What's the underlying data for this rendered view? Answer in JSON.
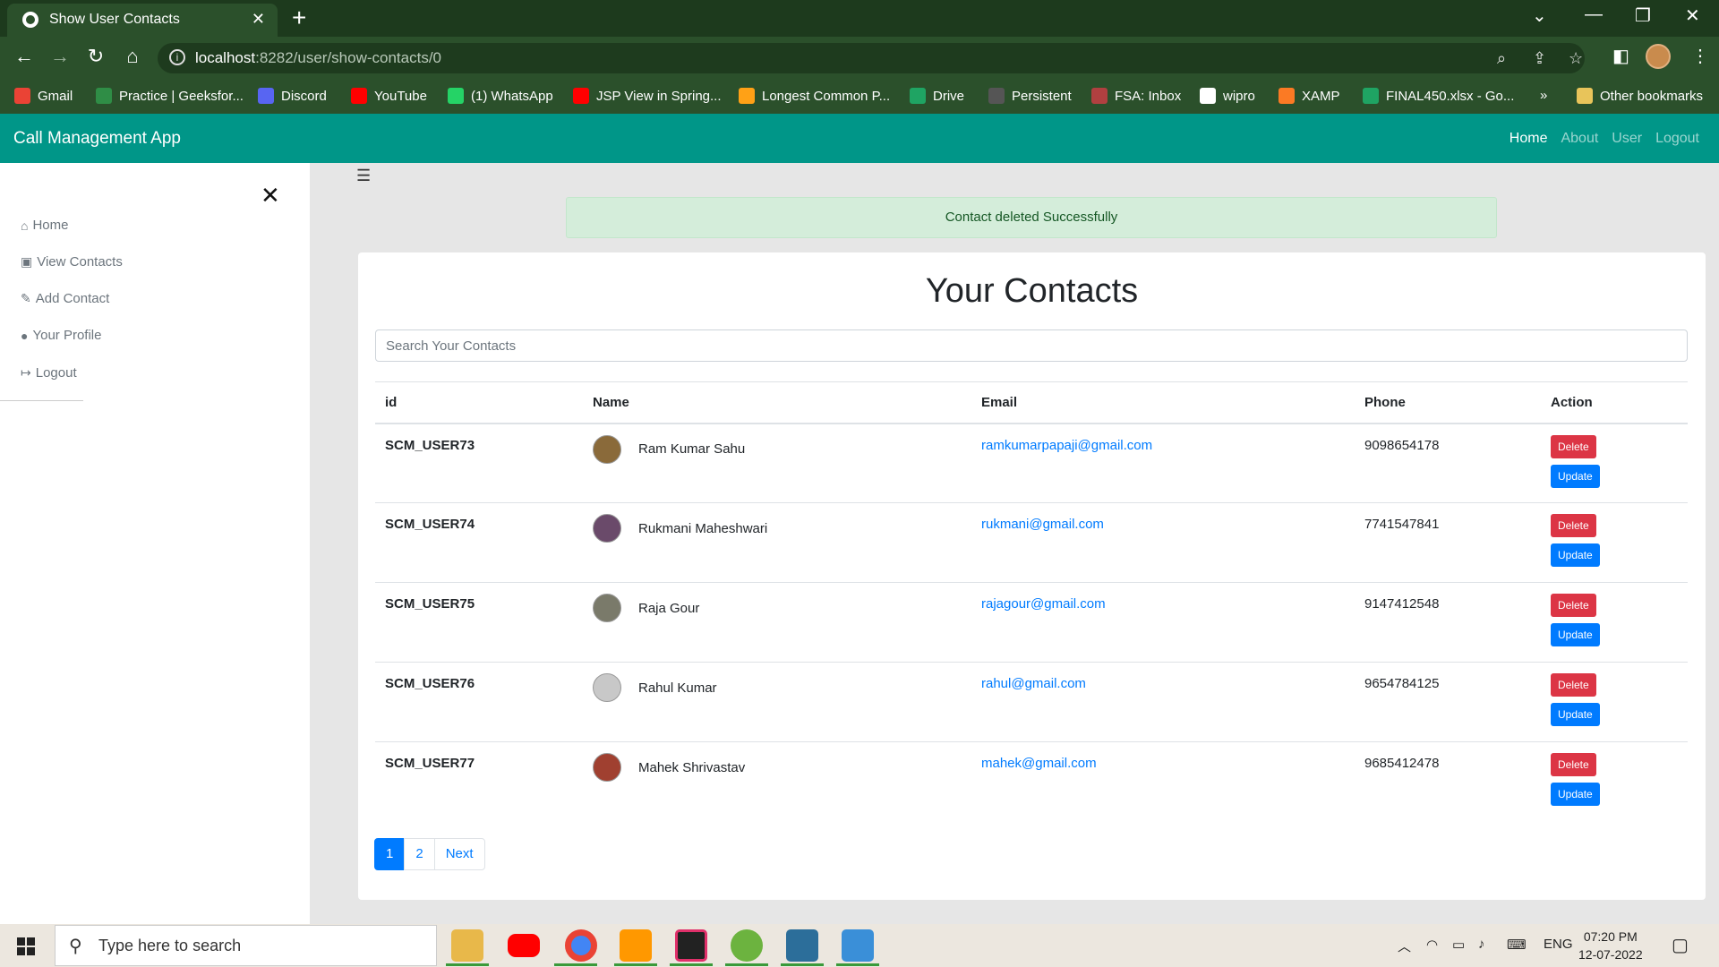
{
  "browser": {
    "tab_title": "Show User Contacts",
    "url_host": "localhost",
    "url_rest": ":8282/user/show-contacts/0",
    "bookmarks": [
      {
        "label": "Gmail",
        "color": "#ea4335"
      },
      {
        "label": "Practice | Geeksfor...",
        "color": "#2f8d46"
      },
      {
        "label": "Discord",
        "color": "#5865f2"
      },
      {
        "label": "YouTube",
        "color": "#ff0000"
      },
      {
        "label": "(1) WhatsApp",
        "color": "#25d366"
      },
      {
        "label": "JSP View in Spring...",
        "color": "#ff0000"
      },
      {
        "label": "Longest Common P...",
        "color": "#ffa116"
      },
      {
        "label": "Drive",
        "color": "#1fa463"
      },
      {
        "label": "Persistent",
        "color": "#555555"
      },
      {
        "label": "FSA: Inbox",
        "color": "#b04040"
      },
      {
        "label": "wipro",
        "color": "#ffffff"
      },
      {
        "label": "XAMP",
        "color": "#fb7a24"
      },
      {
        "label": "FINAL450.xlsx - Go...",
        "color": "#1fa463"
      }
    ],
    "more_bookmarks": "»",
    "other_bookmarks": "Other bookmarks"
  },
  "app": {
    "brand": "Call Management App",
    "nav": [
      "Home",
      "About",
      "User",
      "Logout"
    ]
  },
  "sidebar": {
    "items": [
      {
        "icon": "home-icon",
        "glyph": "⌂",
        "label": "Home"
      },
      {
        "icon": "id-card-icon",
        "glyph": "▣",
        "label": "View Contacts"
      },
      {
        "icon": "pencil-icon",
        "glyph": "✎",
        "label": "Add Contact"
      },
      {
        "icon": "user-circle-icon",
        "glyph": "●",
        "label": "Your Profile"
      },
      {
        "icon": "sign-out-icon",
        "glyph": "↦",
        "label": "Logout"
      }
    ]
  },
  "alert": "Contact deleted Successfully",
  "contacts": {
    "title": "Your Contacts",
    "search_placeholder": "Search Your Contacts",
    "headers": [
      "id",
      "Name",
      "Email",
      "Phone",
      "Action"
    ],
    "delete_label": "Delete",
    "update_label": "Update",
    "rows": [
      {
        "id": "SCM_USER73",
        "name": "Ram Kumar Sahu",
        "email": "ramkumarpapaji@gmail.com",
        "phone": "9098654178",
        "avatar": "#8a6a3a"
      },
      {
        "id": "SCM_USER74",
        "name": "Rukmani Maheshwari",
        "email": "rukmani@gmail.com",
        "phone": "7741547841",
        "avatar": "#6a4a6a"
      },
      {
        "id": "SCM_USER75",
        "name": "Raja Gour",
        "email": "rajagour@gmail.com",
        "phone": "9147412548",
        "avatar": "#7a7a6a"
      },
      {
        "id": "SCM_USER76",
        "name": "Rahul Kumar",
        "email": "rahul@gmail.com",
        "phone": "9654784125",
        "avatar": "#c8c8c8"
      },
      {
        "id": "SCM_USER77",
        "name": "Mahek Shrivastav",
        "email": "mahek@gmail.com",
        "phone": "9685412478",
        "avatar": "#a04030"
      }
    ],
    "pagination": [
      "1",
      "2",
      "Next"
    ]
  },
  "taskbar": {
    "search_placeholder": "Type here to search",
    "lang": "ENG",
    "time": "07:20 PM",
    "date": "12-07-2022"
  }
}
